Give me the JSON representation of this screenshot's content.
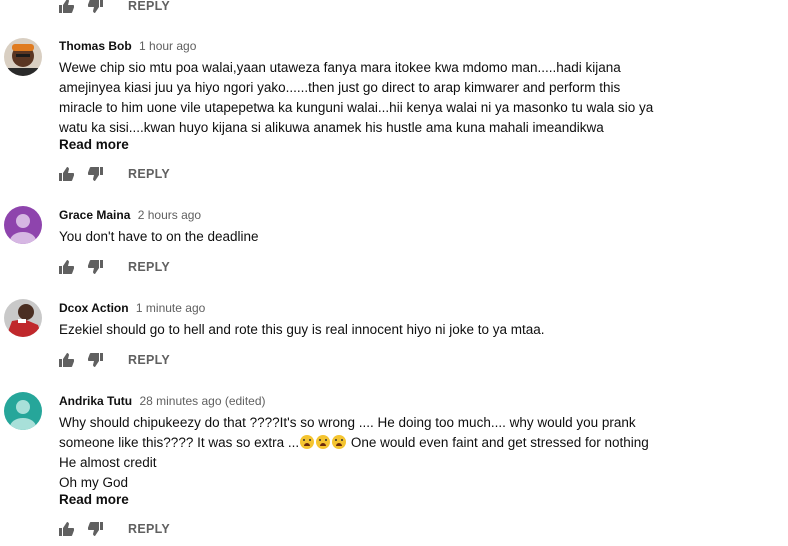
{
  "reply_label": "REPLY",
  "comments": [
    {
      "author": "Thomas Bob",
      "time": "1 hour ago",
      "lines": [
        "Wewe chip sio mtu poa walai,yaan utaweza fanya mara itokee kwa mdomo man.....hadi kijana",
        "amejinyea kiasi juu ya hiyo ngori yako......then just go direct to arap kimwarer and perform this",
        "miracle to him uone vile utapepetwa ka kunguni walai...hii kenya walai ni ya masonko tu wala sio ya",
        "watu ka sisi....kwan huyo kijana si alikuwa anamek his hustle ama kuna mahali imeandikwa"
      ],
      "read_more": "Read more"
    },
    {
      "author": "Grace Maina",
      "time": "2 hours ago",
      "lines": [
        "You don't have to on the deadline"
      ]
    },
    {
      "author": "Dcox Action",
      "time": "1 minute ago",
      "lines": [
        "Ezekiel should go to hell and rote this guy is real innocent hiyo ni joke to ya mtaa."
      ]
    },
    {
      "author": "Andrika Tutu",
      "time": "28 minutes ago (edited)",
      "lines": [
        "Why should chipukeezy do that ????It's so wrong .... He doing too much.... why would you prank",
        "someone like this???? It was so extra ...",
        "He almost credit",
        "Oh my God"
      ],
      "line2_suffix": " One would even faint and get stressed for nothing",
      "read_more": "Read more"
    }
  ],
  "colors": {
    "icon": "#606060",
    "avatar_grace": "#8e44ad",
    "avatar_andrika": "#26a69a"
  },
  "icons": [
    "thumb-up-icon",
    "thumb-down-icon"
  ]
}
